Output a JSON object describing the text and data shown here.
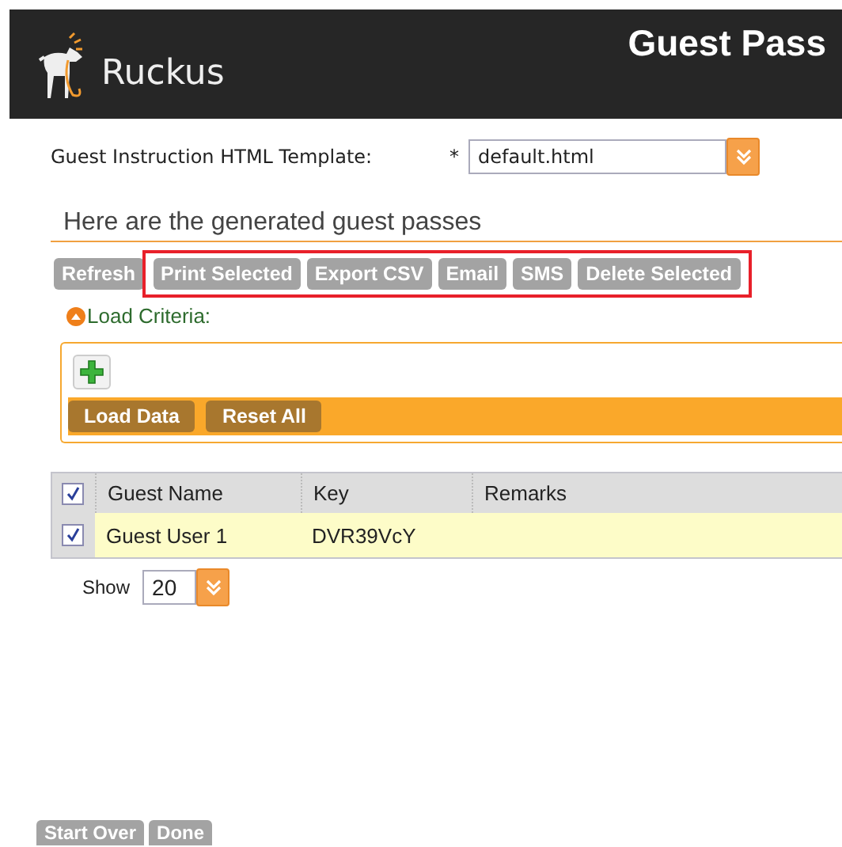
{
  "header": {
    "logo": "Ruckus",
    "title": "Guest Pass"
  },
  "template": {
    "label": "Guest Instruction HTML Template:",
    "required_mark": "*",
    "value": "default.html"
  },
  "section_title": "Here are the generated guest passes",
  "actions": [
    {
      "label": "Refresh",
      "highlighted": false
    },
    {
      "label": "Print Selected",
      "highlighted": true
    },
    {
      "label": "Export CSV",
      "highlighted": true
    },
    {
      "label": "Email",
      "highlighted": true
    },
    {
      "label": "SMS",
      "highlighted": true
    },
    {
      "label": "Delete Selected",
      "highlighted": true
    }
  ],
  "load_criteria": {
    "label": "Load Criteria:",
    "expanded": true,
    "buttons": [
      "Load Data",
      "Reset All"
    ]
  },
  "table": {
    "all_checked": true,
    "columns": [
      "Guest Name",
      "Key",
      "Remarks"
    ],
    "rows": [
      {
        "cells": [
          "Guest User 1",
          "DVR39VcY",
          ""
        ],
        "checked": true,
        "selected": true
      }
    ]
  },
  "pager": {
    "label": "Show",
    "value": "20"
  },
  "footer_buttons": [
    "Start Over",
    "Done"
  ]
}
